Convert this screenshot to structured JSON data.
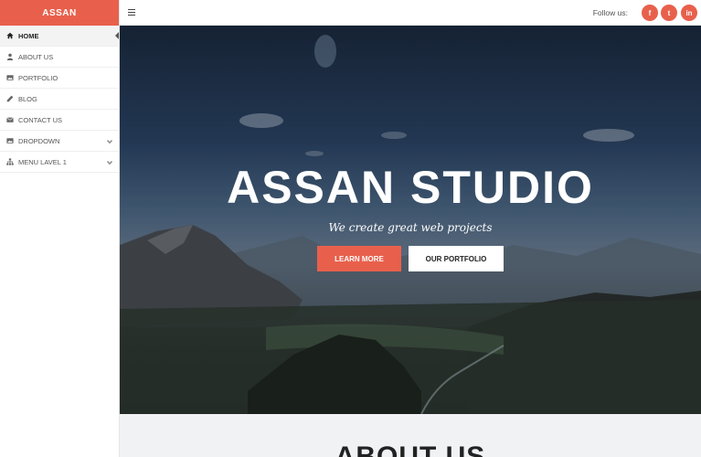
{
  "brand": "ASSAN",
  "sidebar": {
    "items": [
      {
        "label": "HOME",
        "icon": "home-icon"
      },
      {
        "label": "ABOUT US",
        "icon": "user-icon"
      },
      {
        "label": "PORTFOLIO",
        "icon": "image-icon"
      },
      {
        "label": "BLOG",
        "icon": "pencil-icon"
      },
      {
        "label": "CONTACT US",
        "icon": "envelope-icon"
      },
      {
        "label": "DROPDOWN",
        "icon": "image-icon"
      },
      {
        "label": "MENU LAVEL 1",
        "icon": "sitemap-icon"
      }
    ]
  },
  "header": {
    "follow_label": "Follow us:",
    "social": [
      {
        "label": "f",
        "icon": "facebook-icon"
      },
      {
        "label": "t",
        "icon": "twitter-icon"
      },
      {
        "label": "in",
        "icon": "linkedin-icon"
      }
    ]
  },
  "hero": {
    "title": "ASSAN STUDIO",
    "subtitle": "We create great web projects",
    "primary_button": "LEARN MORE",
    "secondary_button": "OUR PORTFOLIO"
  },
  "about": {
    "heading": "ABOUT US"
  },
  "colors": {
    "accent": "#e8604c"
  }
}
